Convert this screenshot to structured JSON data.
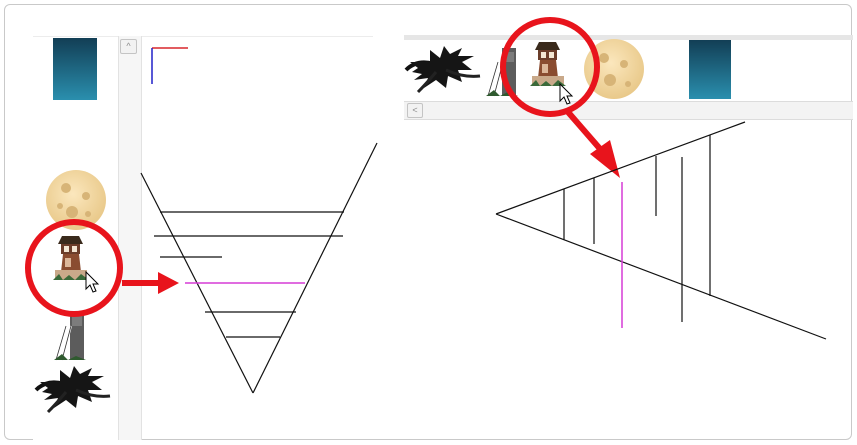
{
  "left_panel": {
    "scroll_up_glyph": "^",
    "thumbnails": [
      {
        "name": "blue-gradient-drawing",
        "icon": "gradient-swatch-icon"
      },
      {
        "name": "moon-drawing",
        "icon": "moon-icon"
      },
      {
        "name": "tower-drawing",
        "icon": "tower-icon"
      },
      {
        "name": "ladder-tower-drawing",
        "icon": "ladder-icon"
      },
      {
        "name": "palm-tree-drawing",
        "icon": "palm-tree-icon"
      }
    ]
  },
  "right_panel": {
    "scroll_left_glyph": "<",
    "thumbnails": [
      {
        "name": "palm-tree-drawing",
        "icon": "palm-tree-icon"
      },
      {
        "name": "ladder-tower-drawing",
        "icon": "ladder-icon"
      },
      {
        "name": "tower-drawing",
        "icon": "tower-icon"
      },
      {
        "name": "moon-drawing",
        "icon": "moon-icon"
      },
      {
        "name": "blue-gradient-drawing",
        "icon": "gradient-swatch-icon"
      }
    ]
  },
  "colors": {
    "highlight_red": "#e8141c",
    "insert_marker": "#d63cd6",
    "current_frame_red": "#d9262b",
    "current_frame_blue": "#2020c8"
  }
}
